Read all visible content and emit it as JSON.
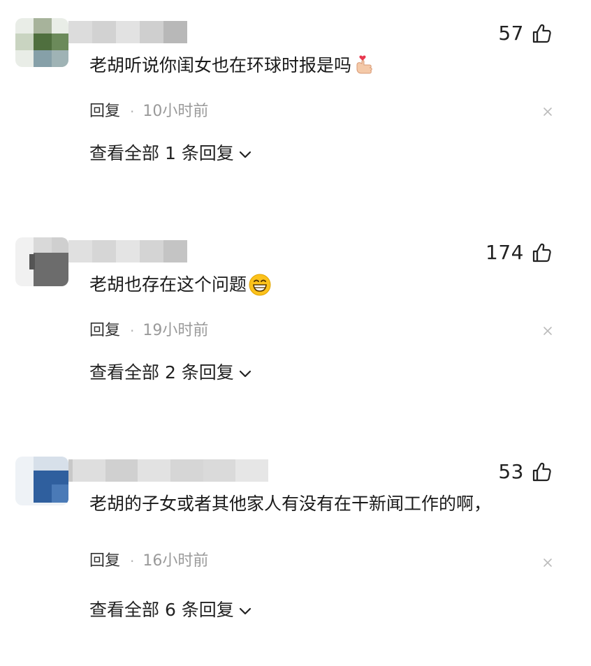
{
  "comments": [
    {
      "likes": "57",
      "text": "老胡听说你闺女也在环球时报是吗",
      "emoji": "heart-hand-emoji",
      "reply_label": "回复",
      "separator": "·",
      "time": "10小时前",
      "view_replies": "查看全部 1 条回复"
    },
    {
      "likes": "174",
      "text": "老胡也存在这个问题",
      "emoji": "grinning-face-emoji",
      "reply_label": "回复",
      "separator": "·",
      "time": "19小时前",
      "view_replies": "查看全部 2 条回复"
    },
    {
      "likes": "53",
      "text": "老胡的子女或者其他家人有没有在干新闻工作的啊，",
      "emoji": "",
      "reply_label": "回复",
      "separator": "·",
      "time": "16小时前",
      "view_replies": "查看全部 6 条回复"
    }
  ],
  "icons": {
    "like": "thumbs-up-icon",
    "close": "close-icon",
    "expand": "chevron-down-icon"
  },
  "colors": {
    "text": "#1a1a1a",
    "meta": "#9a9a9a",
    "close": "#bbbbbb"
  }
}
